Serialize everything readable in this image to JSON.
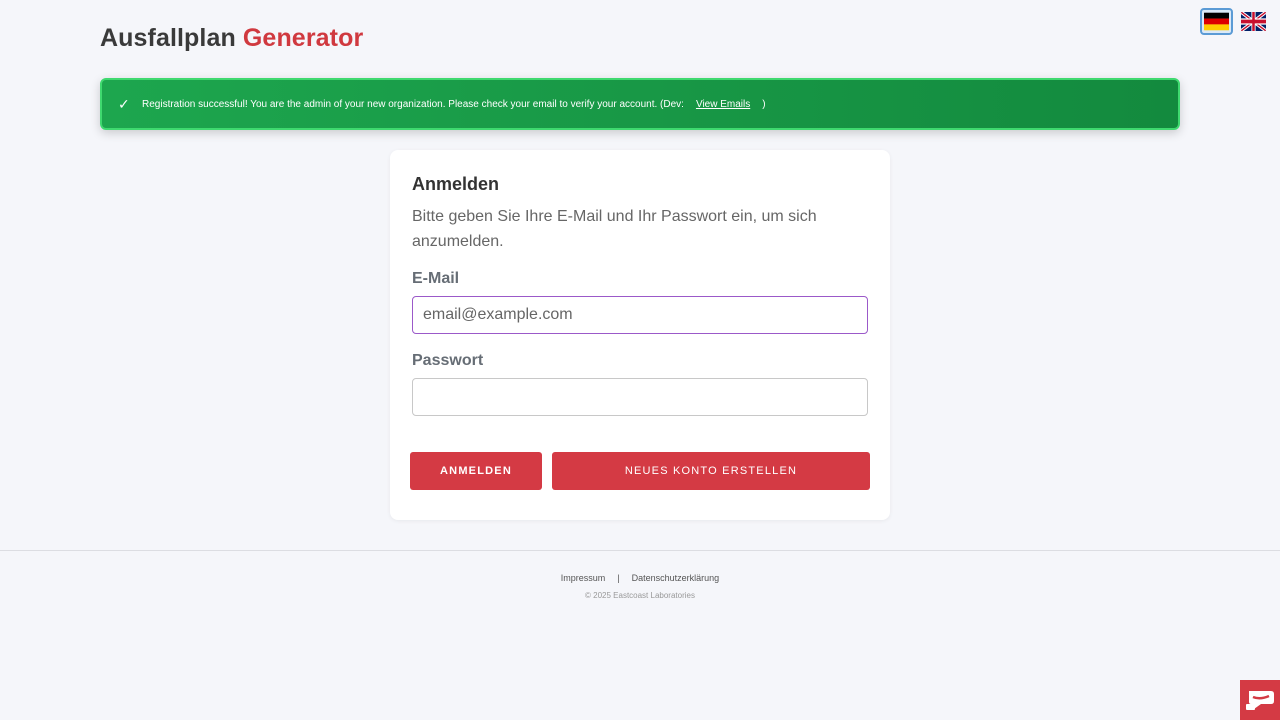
{
  "header": {
    "title_part1": "Ausfallplan",
    "title_part2": "Generator"
  },
  "language": {
    "options": [
      {
        "code": "de",
        "icon": "german-flag-icon",
        "active": true
      },
      {
        "code": "en",
        "icon": "uk-flag-icon",
        "active": false
      }
    ]
  },
  "alert": {
    "icon": "check-icon",
    "check_glyph": "✓",
    "message": "Registration successful! You are the admin of your new organization. Please check your email to verify your account. (Dev:",
    "link_text": "View Emails",
    "suffix": ")",
    "color": "#1da64e"
  },
  "login": {
    "title": "Anmelden",
    "description": "Bitte geben Sie Ihre E-Mail und Ihr Passwort ein, um sich anzumelden.",
    "email_label": "E-Mail",
    "email_placeholder": "email@example.com",
    "email_value": "",
    "password_label": "Passwort",
    "password_value": "",
    "login_button": "Anmelden",
    "register_button": "Neues Konto erstellen"
  },
  "footer": {
    "impressum": "Impressum",
    "separator": "|",
    "privacy": "Datenschutzerklärung",
    "copyright": "© 2025 Eastcoast Laboratories"
  },
  "colors": {
    "accent": "#d43a44",
    "background": "#f5f6fa"
  },
  "corner_widget": {
    "icon": "chat-widget-icon"
  }
}
